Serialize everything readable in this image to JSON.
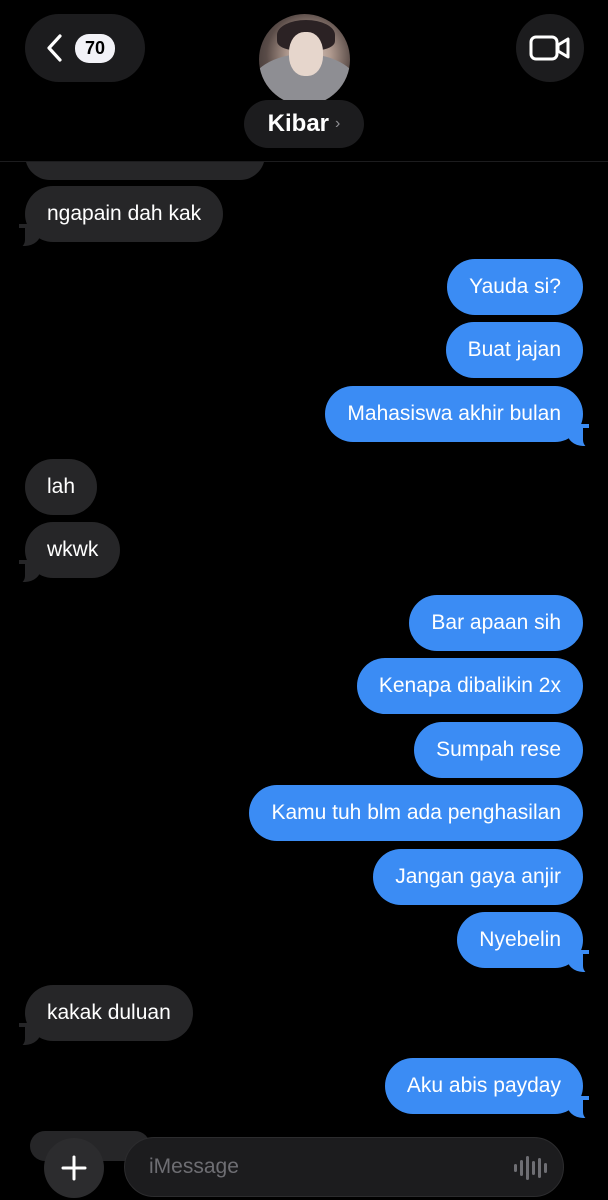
{
  "header": {
    "unread_count": "70",
    "contact_name": "Kibar",
    "back_icon": "chevron-left-icon",
    "video_icon": "video-camera-icon"
  },
  "messages": [
    {
      "dir": "in",
      "text": "ngapain dah kak"
    },
    {
      "dir": "out",
      "text": "Yauda si?"
    },
    {
      "dir": "out",
      "text": "Buat jajan"
    },
    {
      "dir": "out",
      "text": "Mahasiswa akhir bulan"
    },
    {
      "dir": "in",
      "text": "lah"
    },
    {
      "dir": "in",
      "text": "wkwk"
    },
    {
      "dir": "out",
      "text": "Bar apaan sih"
    },
    {
      "dir": "out",
      "text": "Kenapa dibalikin 2x"
    },
    {
      "dir": "out",
      "text": "Sumpah rese"
    },
    {
      "dir": "out",
      "text": "Kamu tuh blm ada penghasilan"
    },
    {
      "dir": "out",
      "text": "Jangan gaya anjir"
    },
    {
      "dir": "out",
      "text": "Nyebelin"
    },
    {
      "dir": "in",
      "text": "kakak duluan"
    },
    {
      "dir": "out",
      "text": "Aku abis payday"
    }
  ],
  "composer": {
    "placeholder": "iMessage",
    "plus_icon": "plus-icon",
    "audio_icon": "waveform-icon"
  },
  "colors": {
    "outgoing_bubble": "#3b8cf4",
    "incoming_bubble": "#262628",
    "background": "#000000"
  }
}
